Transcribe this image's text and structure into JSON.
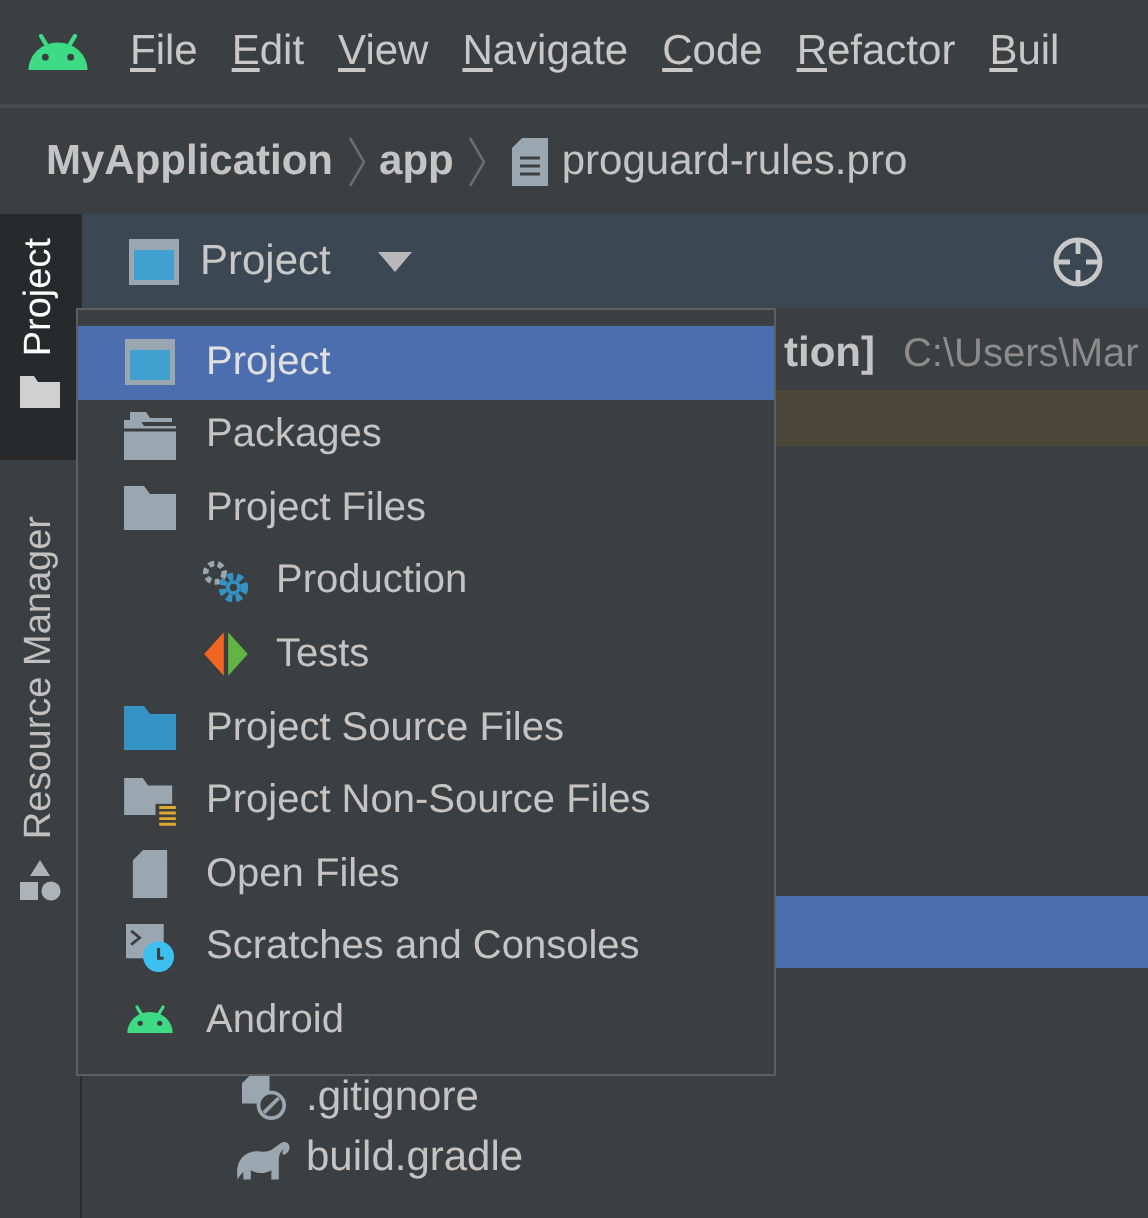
{
  "menu_bar": {
    "items": [
      {
        "label": "File"
      },
      {
        "label": "Edit"
      },
      {
        "label": "View"
      },
      {
        "label": "Navigate"
      },
      {
        "label": "Code"
      },
      {
        "label": "Refactor"
      },
      {
        "label": "Buil"
      }
    ]
  },
  "breadcrumbs": [
    {
      "label": "MyApplication",
      "kind": "folder"
    },
    {
      "label": "app",
      "kind": "folder"
    },
    {
      "label": "proguard-rules.pro",
      "kind": "file"
    }
  ],
  "side_tabs": [
    {
      "label": "Project",
      "selected": true
    },
    {
      "label": "Resource Manager",
      "selected": false
    }
  ],
  "tool_window": {
    "title": "Project"
  },
  "tree": {
    "rows": [
      {
        "kind": "path",
        "label": "tion]",
        "path": "C:\\Users\\Mar",
        "selected": false,
        "highlighted": false
      },
      {
        "kind": "blank",
        "selected": false,
        "highlighted": true
      },
      {
        "kind": "blank",
        "selected": true,
        "highlighted": false
      },
      {
        "kind": "gitignore",
        "label": ".gitignore",
        "selected": false,
        "highlighted": false
      },
      {
        "kind": "gradle",
        "label": "build.gradle",
        "selected": false,
        "highlighted": false
      }
    ]
  },
  "view_menu": {
    "items": [
      {
        "label": "Project",
        "kind": "window",
        "selected": true
      },
      {
        "label": "Packages",
        "kind": "packages",
        "selected": false
      },
      {
        "label": "Project Files",
        "kind": "folder",
        "selected": false,
        "children": [
          {
            "label": "Production",
            "kind": "gears",
            "selected": false
          },
          {
            "label": "Tests",
            "kind": "tests",
            "selected": false
          }
        ]
      },
      {
        "label": "Project Source Files",
        "kind": "source",
        "selected": false
      },
      {
        "label": "Project Non-Source Files",
        "kind": "nonsource",
        "selected": false
      },
      {
        "label": "Open Files",
        "kind": "doc",
        "selected": false
      },
      {
        "label": "Scratches and Consoles",
        "kind": "scratch",
        "selected": false
      },
      {
        "label": "Android",
        "kind": "android",
        "selected": false
      }
    ]
  }
}
